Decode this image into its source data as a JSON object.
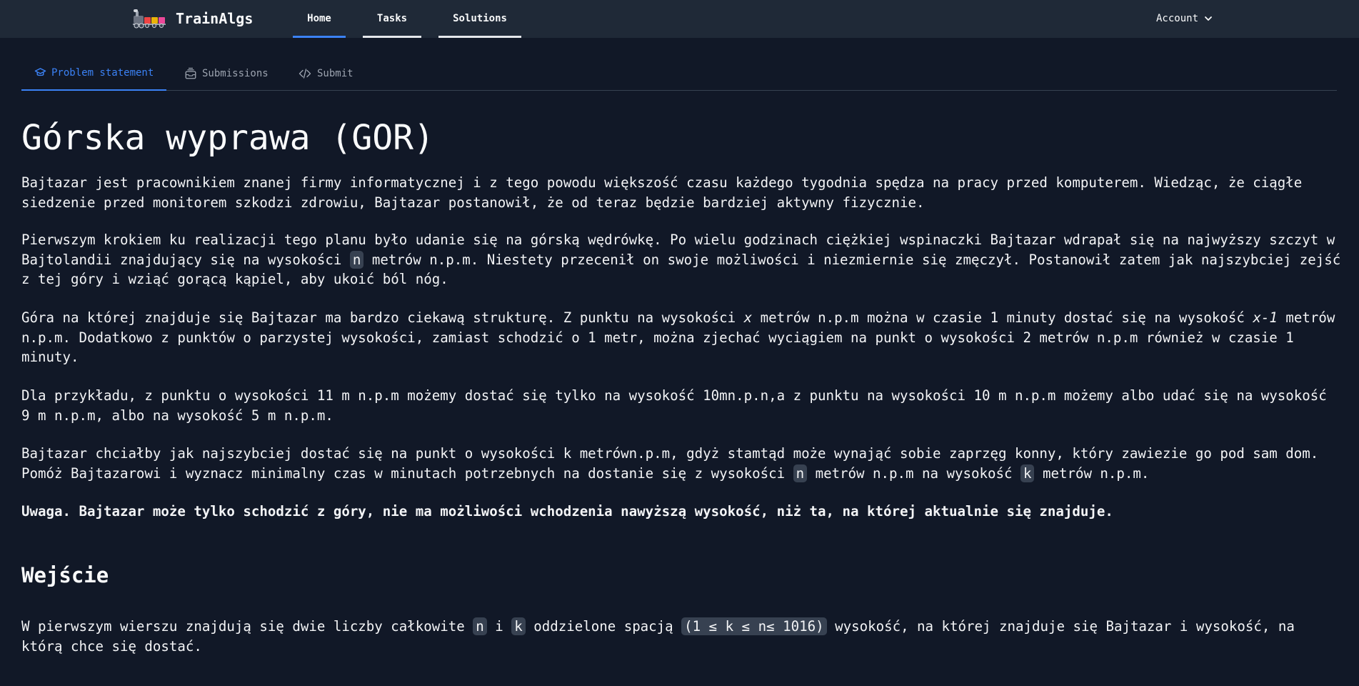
{
  "brand": {
    "name": "TrainAlgs",
    "logo": "train-logo"
  },
  "nav": {
    "tabs": [
      {
        "label": "Home",
        "active": true
      },
      {
        "label": "Tasks",
        "active": false
      },
      {
        "label": "Solutions",
        "active": false
      }
    ],
    "account_label": "Account"
  },
  "subtabs": [
    {
      "label": "Problem statement",
      "icon": "graduation-cap-icon",
      "active": true
    },
    {
      "label": "Submissions",
      "icon": "inbox-stack-icon",
      "active": false
    },
    {
      "label": "Submit",
      "icon": "code-brackets-icon",
      "active": false
    }
  ],
  "problem": {
    "title": "Górska wyprawa (GOR)",
    "p1": "Bajtazar jest pracownikiem znanej firmy informatycznej i z tego powodu większość czasu każdego tygodnia spędza na pracy przed komputerem. Wiedząc, że ciągłe siedzenie przed monitorem szkodzi zdrowiu, Bajtazar postanowił, że od teraz będzie bardziej aktywny fizycznie.",
    "p2_a": "Pierwszym krokiem ku realizacji tego planu było udanie się na górską wędrówkę. Po wielu godzinach ciężkiej wspinaczki Bajtazar wdrapał się na najwyższy szczyt w Bajtolandii znajdujący się na wysokości ",
    "p2_code": "n",
    "p2_b": " metrów n.p.m. Niestety przecenił on swoje możliwości i niezmiernie się zmęczył. Postanowił zatem jak najszybciej zejść z tej góry i wziąć gorącą kąpiel, aby ukoić ból nóg.",
    "p3_a": "Góra na której znajduje się Bajtazar ma bardzo ciekawą strukturę. Z punktu na wysokości ",
    "p3_x": "x",
    "p3_b": " metrów n.p.m można w czasie 1 minuty dostać się na wysokość ",
    "p3_x1": "x-1",
    "p3_c": " metrów n.p.m. Dodatkowo z punktów o parzystej wysokości, zamiast schodzić o 1 metr, można zjechać wyciągiem na punkt o wysokości 2 metrów n.p.m również w czasie 1 minuty.",
    "p4": "Dla przykładu, z punktu o wysokości 11 m n.p.m możemy dostać się tylko na wysokość 10mn.p.n,a z punktu na wysokości 10 m n.p.m możemy albo udać się na wysokość 9 m n.p.m, albo na wysokość 5 m n.p.m.",
    "p5_a": "Bajtazar chciałby jak najszybciej dostać się na punkt o wysokości k metrówn.p.m, gdyż stamtąd może wynająć sobie zaprzęg konny, który zawiezie go pod sam dom. Pomóż Bajtazarowi i wyznacz minimalny czas w minutach potrzebnych na dostanie się z wysokości ",
    "p5_n": "n",
    "p5_b": " metrów n.p.m na wysokość ",
    "p5_k": "k",
    "p5_c": " metrów n.p.m.",
    "note": "Uwaga. Bajtazar może tylko schodzić z góry, nie ma możliwości wchodzenia nawyższą wysokość, niż ta, na której aktualnie się znajduje.",
    "input_heading": "Wejście",
    "in_a": "W pierwszym wierszu znajdują się dwie liczby całkowite ",
    "in_n": "n",
    "in_i": " i ",
    "in_k": "k",
    "in_b": " oddzielone spacją ",
    "in_range": "(1 ≤ k ≤ n≤ 1016)",
    "in_c": " wysokość, na której znajduje się Bajtazar i wysokość, na którą chce się dostać."
  },
  "colors": {
    "background": "#111827",
    "navbar": "#1f2937",
    "accent": "#3b82f6",
    "code_bg": "#374151"
  }
}
